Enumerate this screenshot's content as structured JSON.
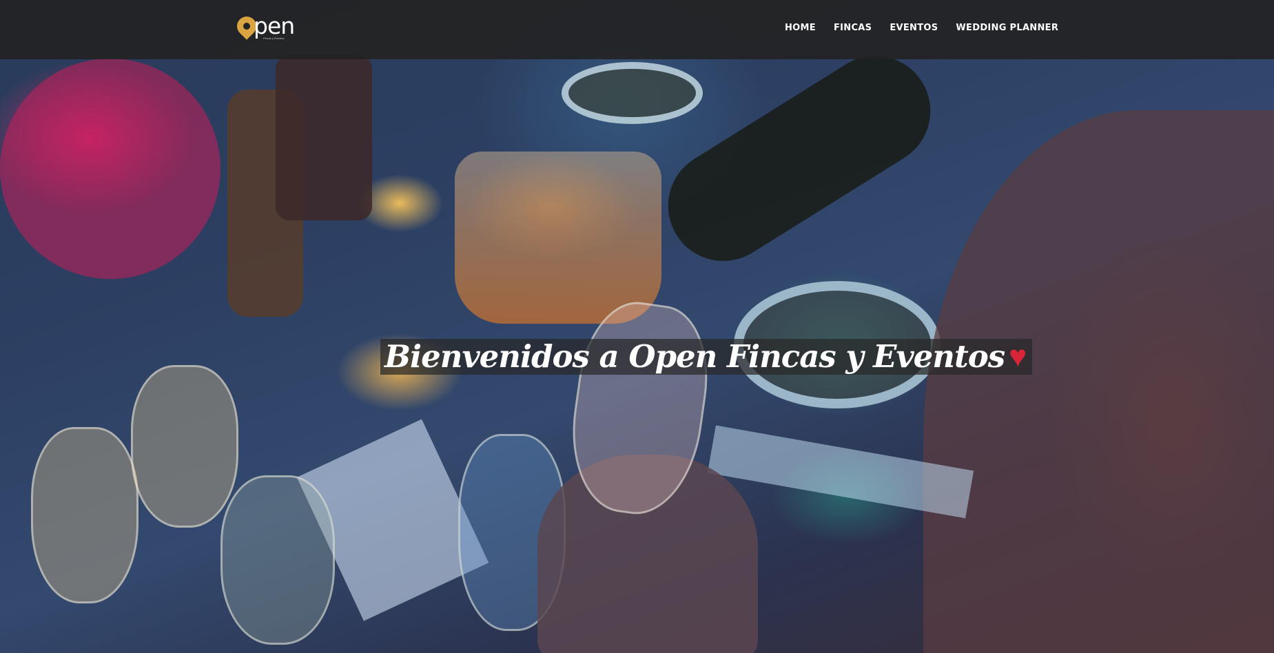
{
  "header": {
    "logo": {
      "text": "pen",
      "tagline": "Fincas y Eventos",
      "accent_color": "#d9a441",
      "icon": "map-pin-icon"
    },
    "nav": [
      {
        "label": "HOME"
      },
      {
        "label": "FINCAS"
      },
      {
        "label": "EVENTOS"
      },
      {
        "label": "WEDDING PLANNER"
      }
    ]
  },
  "hero": {
    "headline": "Bienvenidos a Open Fincas y Eventos",
    "heart": "♥",
    "heart_color": "#d8253a"
  }
}
